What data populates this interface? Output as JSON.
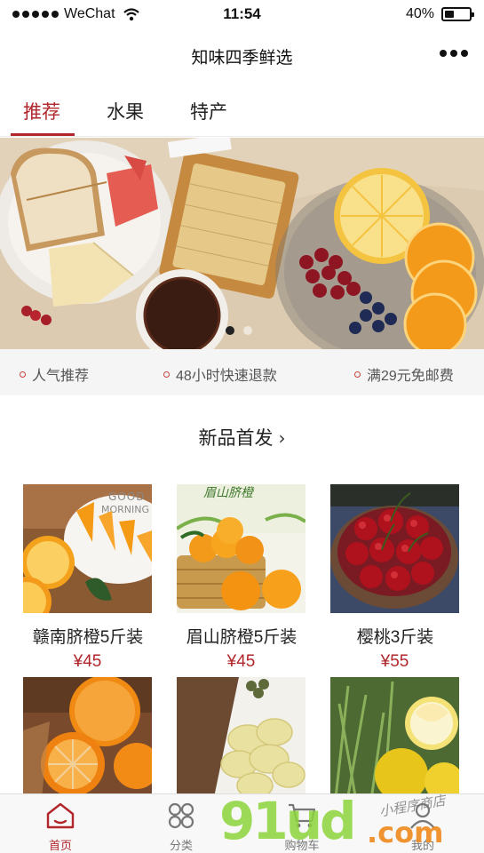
{
  "status_bar": {
    "carrier": "WeChat",
    "time": "11:54",
    "battery": "40%",
    "battery_level": 0.4
  },
  "nav": {
    "title": "知味四季鲜选"
  },
  "tabs": [
    {
      "label": "推荐",
      "active": true
    },
    {
      "label": "水果",
      "active": false
    },
    {
      "label": "特产",
      "active": false
    }
  ],
  "banner": {
    "page_count": 2,
    "current_page": 1
  },
  "promises": [
    "人气推荐",
    "48小时快速退款",
    "满29元免邮费"
  ],
  "section": {
    "title": "新品首发",
    "chevron": "›"
  },
  "products": [
    {
      "name": "赣南脐橙5斤装",
      "price": "¥45",
      "image": "orange-slices-plate"
    },
    {
      "name": "眉山脐橙5斤装",
      "price": "¥45",
      "image": "oranges-basket"
    },
    {
      "name": "樱桃3斤装",
      "price": "¥55",
      "image": "cherries-bowl"
    },
    {
      "name": "",
      "price": "",
      "image": "peeled-tangerines"
    },
    {
      "name": "",
      "price": "",
      "image": "pomelo-segments"
    },
    {
      "name": "",
      "price": "",
      "image": "citrus-on-grass"
    }
  ],
  "tabbar": [
    {
      "label": "首页",
      "icon": "home-icon",
      "active": true
    },
    {
      "label": "分类",
      "icon": "category-icon",
      "active": false
    },
    {
      "label": "购物车",
      "icon": "cart-icon",
      "active": false
    },
    {
      "label": "我的",
      "icon": "user-icon",
      "active": false
    }
  ],
  "watermark": {
    "brand": "91ud",
    "tld": ".com",
    "tagline": "小程序商店"
  },
  "colors": {
    "accent": "#b0262b",
    "promise_bg": "#f5f5f5",
    "tabbar_bg": "#f8f8f8"
  }
}
